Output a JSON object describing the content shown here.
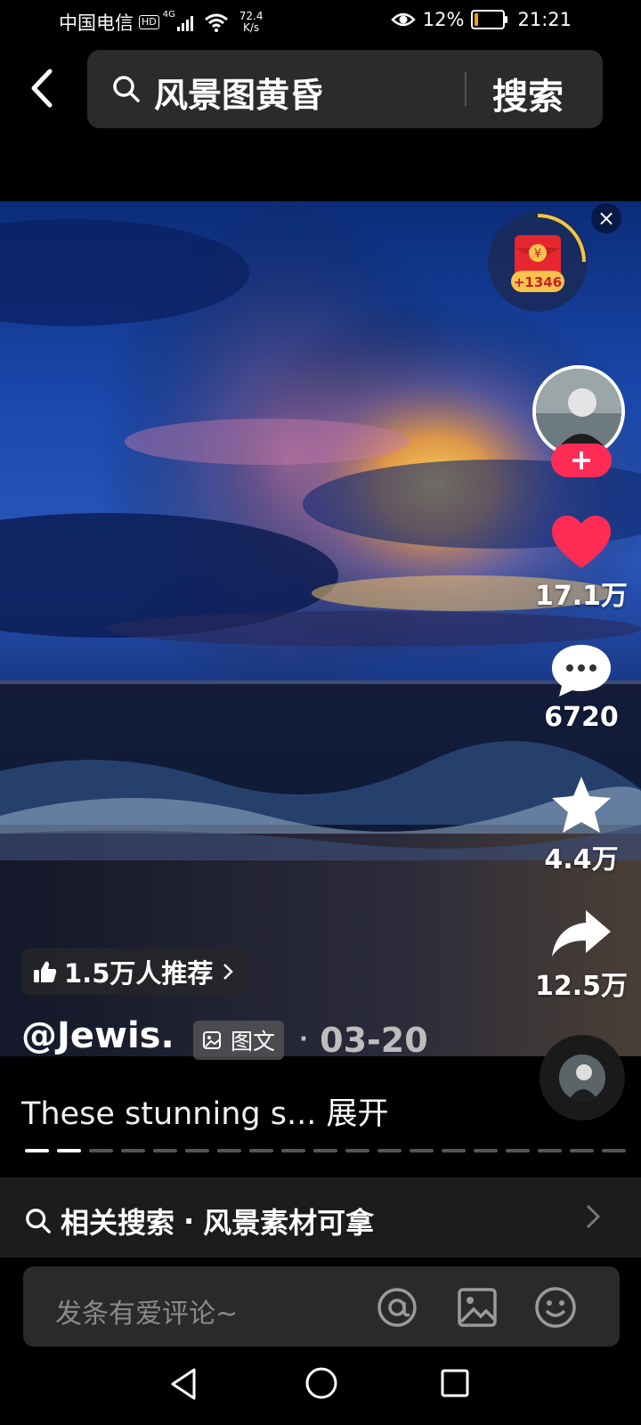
{
  "status_bar": {
    "carrier": "中国电信",
    "hd": "HD",
    "signal_type": "4G",
    "net_speed_value": "72.4",
    "net_speed_unit": "K/s",
    "battery_percent": "12%",
    "time": "21:21"
  },
  "search": {
    "query": "风景图黄昏",
    "button_label": "搜索"
  },
  "post": {
    "red_packet_amount": "+1346",
    "red_packet_symbol": "¥",
    "likes": "17.1万",
    "comments": "6720",
    "favorites": "4.4万",
    "shares": "12.5万",
    "recommend_label": "1.5万人推荐",
    "author": "@Jewis.",
    "type_tag": "图文",
    "date_sep": "·",
    "date": "03-20",
    "description": "These stunning s...",
    "expand_label": "展开",
    "image_count": 19,
    "current_image": 2
  },
  "related_search": {
    "label": "相关搜索",
    "sep": "·",
    "term": "风景素材可拿"
  },
  "comment_box": {
    "placeholder": "发条有爱评论~"
  },
  "colors": {
    "accent": "#fe2c55",
    "like": "#fe2c55",
    "packet": "#e8262f"
  }
}
